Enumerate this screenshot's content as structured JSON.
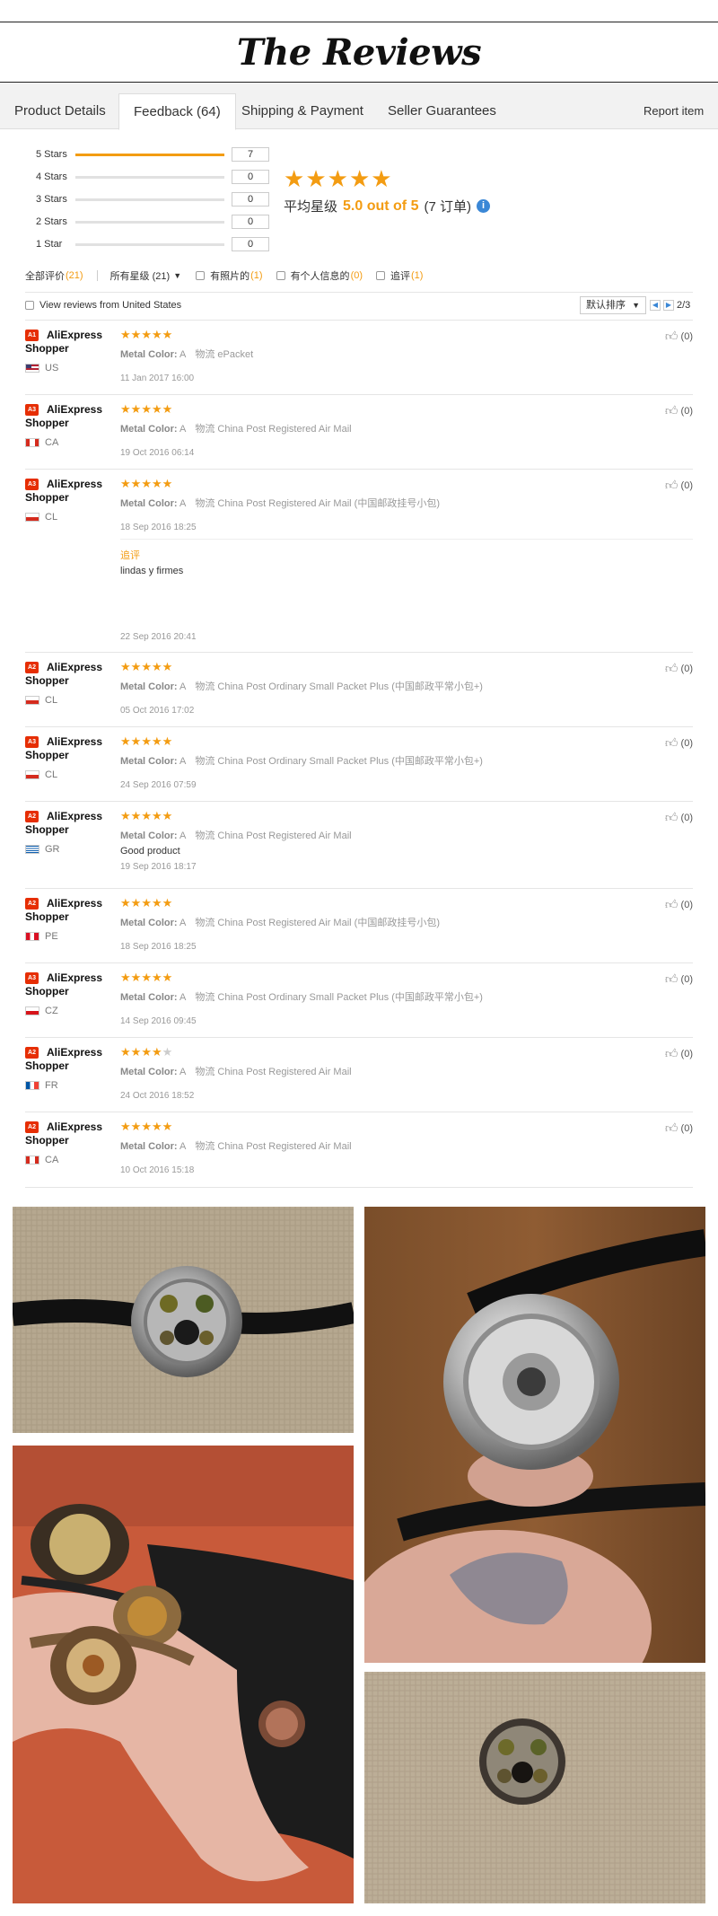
{
  "title": "The Reviews",
  "tabs": [
    {
      "label": "Product Details"
    },
    {
      "label": "Feedback (64)"
    },
    {
      "label": "Shipping & Payment"
    },
    {
      "label": "Seller Guarantees"
    }
  ],
  "report_label": "Report item",
  "summary": {
    "rows": [
      {
        "label": "5 Stars",
        "count": "7",
        "fraction": 1.0
      },
      {
        "label": "4 Stars",
        "count": "0",
        "fraction": 0
      },
      {
        "label": "3 Stars",
        "count": "0",
        "fraction": 0
      },
      {
        "label": "2 Stars",
        "count": "0",
        "fraction": 0
      },
      {
        "label": "1 Star",
        "count": "0",
        "fraction": 0
      }
    ],
    "avg_label": "平均星级",
    "avg_score": "5.0 out of 5",
    "avg_orders": "(7 订单)",
    "avg_star_count": 5
  },
  "filters": {
    "all": "全部评价",
    "all_n": "(21)",
    "stars_select": "所有星级 (21)",
    "photos": "有照片的",
    "photos_n": "(1)",
    "personal": "有个人信息的",
    "personal_n": "(0)",
    "additional": "追评",
    "additional_n": "(1)"
  },
  "view_us_label": "View reviews from United States",
  "sort_label": "默认排序",
  "page_label": "2/3",
  "review_defaults": {
    "user": "AliExpress Shopper",
    "metal_label": "Metal Color:",
    "metal_value": "A",
    "ship_label": "物流"
  },
  "reviews": [
    {
      "badge": "A1",
      "country": "US",
      "stars": 5,
      "ship": "ePacket",
      "date": "11 Jan 2017 16:00",
      "helpful": "(0)"
    },
    {
      "badge": "A3",
      "country": "CA",
      "stars": 5,
      "ship": "China Post Registered Air Mail",
      "date": "19 Oct 2016 06:14",
      "helpful": "(0)"
    },
    {
      "badge": "A3",
      "country": "CL",
      "stars": 5,
      "ship": "China Post Registered Air Mail (中国邮政挂号小包)",
      "date": "18 Sep 2016 18:25",
      "helpful": "(0)",
      "additional_label": "追评",
      "additional_text": "lindas y firmes",
      "additional_date": "22 Sep 2016 20:41"
    },
    {
      "badge": "A2",
      "country": "CL",
      "stars": 5,
      "ship": "China Post Ordinary Small Packet Plus (中国邮政平常小包+)",
      "date": "05 Oct 2016 17:02",
      "helpful": "(0)"
    },
    {
      "badge": "A3",
      "country": "CL",
      "stars": 5,
      "ship": "China Post Ordinary Small Packet Plus (中国邮政平常小包+)",
      "date": "24 Sep 2016 07:59",
      "helpful": "(0)"
    },
    {
      "badge": "A2",
      "country": "GR",
      "stars": 5,
      "ship": "China Post Registered Air Mail",
      "text": "Good product",
      "date": "19 Sep 2016 18:17",
      "helpful": "(0)"
    },
    {
      "badge": "A2",
      "country": "PE",
      "stars": 5,
      "ship": "China Post Registered Air Mail (中国邮政挂号小包)",
      "date": "18 Sep 2016 18:25",
      "helpful": "(0)"
    },
    {
      "badge": "A3",
      "country": "CZ",
      "stars": 5,
      "ship": "China Post Ordinary Small Packet Plus (中国邮政平常小包+)",
      "date": "14 Sep 2016 09:45",
      "helpful": "(0)"
    },
    {
      "badge": "A2",
      "country": "FR",
      "stars": 4,
      "ship": "China Post Registered Air Mail",
      "date": "24 Oct 2016 18:52",
      "helpful": "(0)"
    },
    {
      "badge": "A2",
      "country": "CA",
      "stars": 5,
      "ship": "China Post Registered Air Mail",
      "date": "10 Oct 2016 15:18",
      "helpful": "(0)"
    }
  ],
  "colors": {
    "accent": "#f39c12",
    "badge": "#e62e04",
    "info": "#3a87d6"
  }
}
